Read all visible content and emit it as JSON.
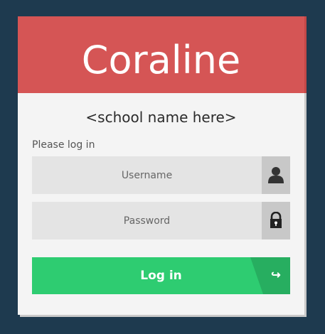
{
  "app": {
    "title": "Coraline",
    "school_name": "<school name here>"
  },
  "form": {
    "prompt": "Please log in",
    "username": {
      "placeholder": "Username",
      "icon": "user-icon",
      "value": ""
    },
    "password": {
      "placeholder": "Password",
      "icon": "lock-icon",
      "value": ""
    },
    "submit": {
      "label": "Log in",
      "icon": "login-arrow-icon",
      "arrow_glyph": "↪"
    }
  },
  "colors": {
    "background": "#1e3a4f",
    "header": "#d55555",
    "card": "#f4f4f4",
    "input": "#e4e4e4",
    "icon_box": "#c8c8c8",
    "button": "#2ecc71",
    "button_tail": "#27ae60"
  }
}
